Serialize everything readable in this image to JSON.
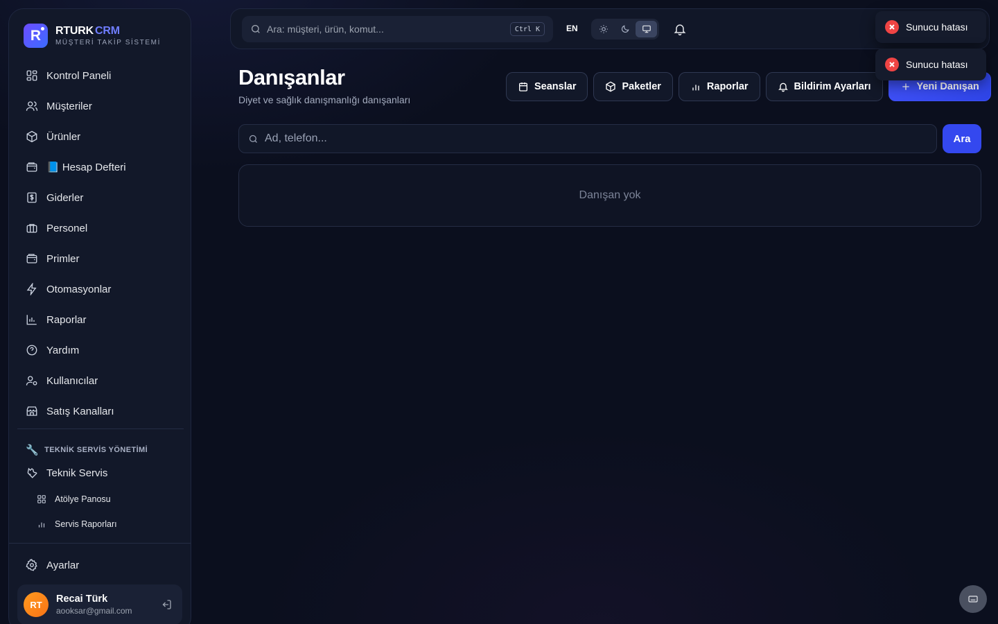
{
  "brand": {
    "name": "RTURK",
    "suffix": "CRM",
    "tagline": "MÜŞTERİ TAKİP SİSTEMİ",
    "logo_letter": "R"
  },
  "sidebar": {
    "items": [
      {
        "label": "Kontrol Paneli",
        "icon": "dashboard-icon"
      },
      {
        "label": "Müşteriler",
        "icon": "users-icon"
      },
      {
        "label": "Ürünler",
        "icon": "box-icon"
      },
      {
        "label": "📘 Hesap Defteri",
        "icon": "wallet-icon"
      },
      {
        "label": "Giderler",
        "icon": "dollar-receipt-icon"
      },
      {
        "label": "Personel",
        "icon": "briefcase-icon"
      },
      {
        "label": "Primler",
        "icon": "wallet-icon"
      },
      {
        "label": "Otomasyonlar",
        "icon": "lightning-icon"
      },
      {
        "label": "Raporlar",
        "icon": "bar-chart-icon"
      },
      {
        "label": "Yardım",
        "icon": "help-icon"
      },
      {
        "label": "Kullanıcılar",
        "icon": "user-settings-icon"
      },
      {
        "label": "Satış Kanalları",
        "icon": "store-icon"
      }
    ],
    "section_title": "TEKNİK SERVİS YÖNETİMİ",
    "section_item": "Teknik Servis",
    "sub_items": [
      {
        "label": "Atölye Panosu",
        "icon": "grid-icon"
      },
      {
        "label": "Servis Raporları",
        "icon": "bar-chart-icon"
      }
    ],
    "settings": "Ayarlar"
  },
  "user": {
    "initials": "RT",
    "name": "Recai Türk",
    "email": "aooksar@gmail.com"
  },
  "topbar": {
    "search_placeholder": "Ara: müşteri, ürün, komut...",
    "shortcut": "Ctrl K",
    "language": "EN",
    "theme_selected": "system"
  },
  "page": {
    "title": "Danışanlar",
    "subtitle": "Diyet ve sağlık danışmanlığı danışanları",
    "actions": {
      "sessions": "Seanslar",
      "packages": "Paketler",
      "reports": "Raporlar",
      "notification_settings": "Bildirim Ayarları",
      "new_client": "Yeni Danışan"
    },
    "search_placeholder": "Ad, telefon...",
    "search_button": "Ara",
    "empty_message": "Danışan yok"
  },
  "toasts": [
    "Sunucu hatası",
    "Sunucu hatası"
  ],
  "colors": {
    "accent": "#3448ef",
    "brand_crm": "#6f7dff",
    "error": "#ef4444",
    "avatar": "#f97316"
  }
}
